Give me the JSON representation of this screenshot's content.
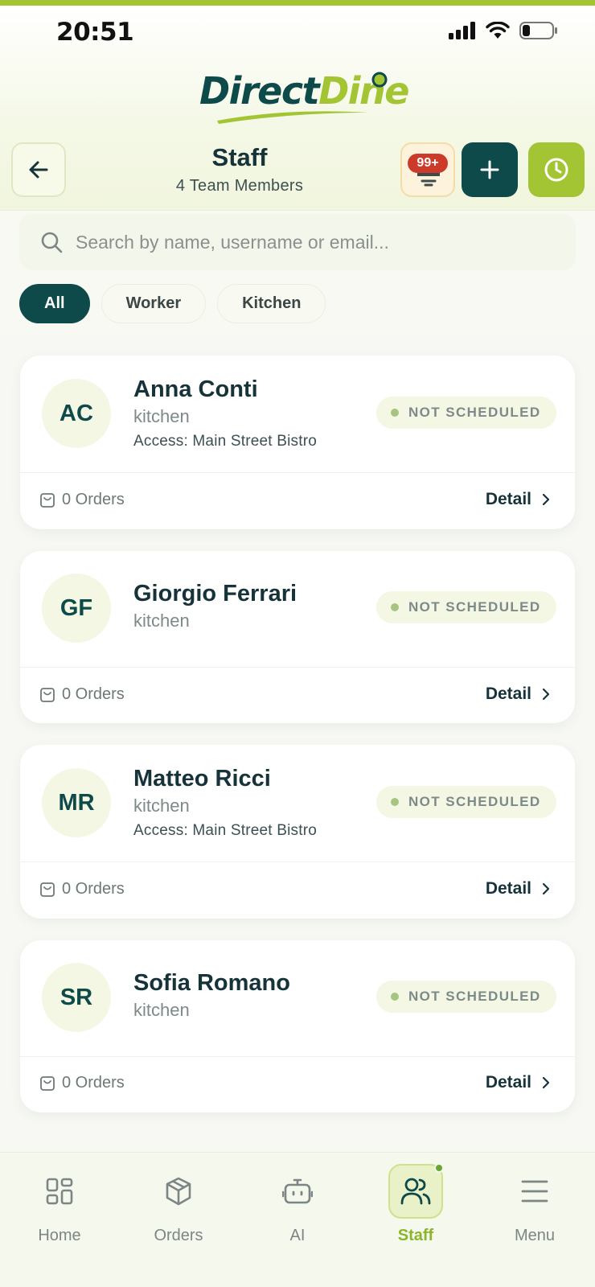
{
  "status_bar": {
    "time": "20:51"
  },
  "brand": {
    "part1": "Direct",
    "part2": "Dine",
    "primary_color": "#0e4a4a",
    "accent_color": "#a3c533"
  },
  "header": {
    "title": "Staff",
    "subtitle": "4 Team Members",
    "notification_badge": "99+"
  },
  "search": {
    "placeholder": "Search by name, username or email..."
  },
  "filters": [
    {
      "label": "All",
      "active": true
    },
    {
      "label": "Worker",
      "active": false
    },
    {
      "label": "Kitchen",
      "active": false
    }
  ],
  "staff": [
    {
      "initials": "AC",
      "name": "Anna Conti",
      "role": "kitchen",
      "access": "Access: Main Street Bistro",
      "status": "NOT SCHEDULED",
      "orders": "0 Orders",
      "detail": "Detail"
    },
    {
      "initials": "GF",
      "name": "Giorgio Ferrari",
      "role": "kitchen",
      "access": "",
      "status": "NOT SCHEDULED",
      "orders": "0 Orders",
      "detail": "Detail"
    },
    {
      "initials": "MR",
      "name": "Matteo Ricci",
      "role": "kitchen",
      "access": "Access: Main Street Bistro",
      "status": "NOT SCHEDULED",
      "orders": "0 Orders",
      "detail": "Detail"
    },
    {
      "initials": "SR",
      "name": "Sofia Romano",
      "role": "kitchen",
      "access": "",
      "status": "NOT SCHEDULED",
      "orders": "0 Orders",
      "detail": "Detail"
    }
  ],
  "nav": [
    {
      "label": "Home",
      "icon": "grid-icon"
    },
    {
      "label": "Orders",
      "icon": "box-icon"
    },
    {
      "label": "AI",
      "icon": "robot-icon"
    },
    {
      "label": "Staff",
      "icon": "users-icon",
      "active": true
    },
    {
      "label": "Menu",
      "icon": "menu-icon"
    }
  ]
}
